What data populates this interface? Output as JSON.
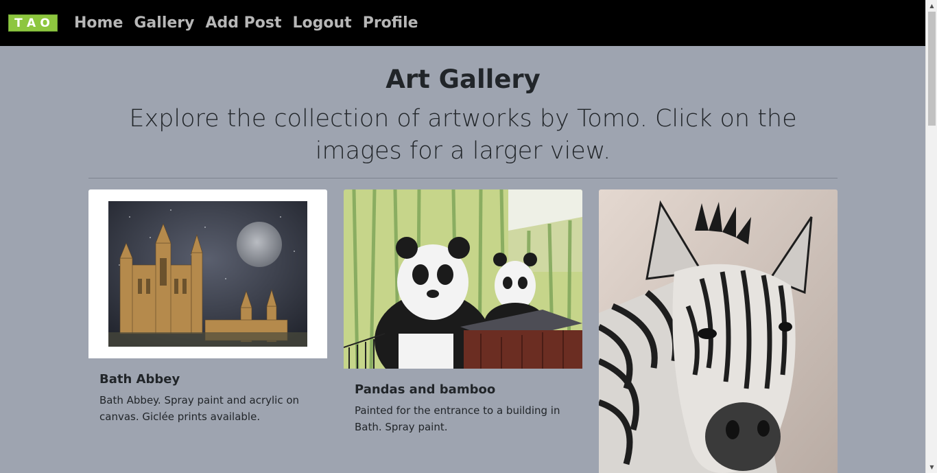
{
  "navbar": {
    "logo_letters": [
      "T",
      "A",
      "O"
    ],
    "links": [
      "Home",
      "Gallery",
      "Add Post",
      "Logout",
      "Profile"
    ]
  },
  "header": {
    "title": "Art Gallery",
    "lead": "Explore the collection of artworks by Tomo. Click on the images for a larger view."
  },
  "cards": [
    {
      "title": "Bath Abbey",
      "text": "Bath Abbey. Spray paint and acrylic on canvas. Giclée prints available."
    },
    {
      "title": "Pandas and bamboo",
      "text": "Painted for the entrance to a building in Bath. Spray paint."
    },
    {
      "title": "",
      "text": ""
    }
  ],
  "colors": {
    "page_bg": "#9ea4b0",
    "navbar_bg": "#000000",
    "logo_green": "#8dc63f",
    "nav_link": "#b7b7b7"
  }
}
